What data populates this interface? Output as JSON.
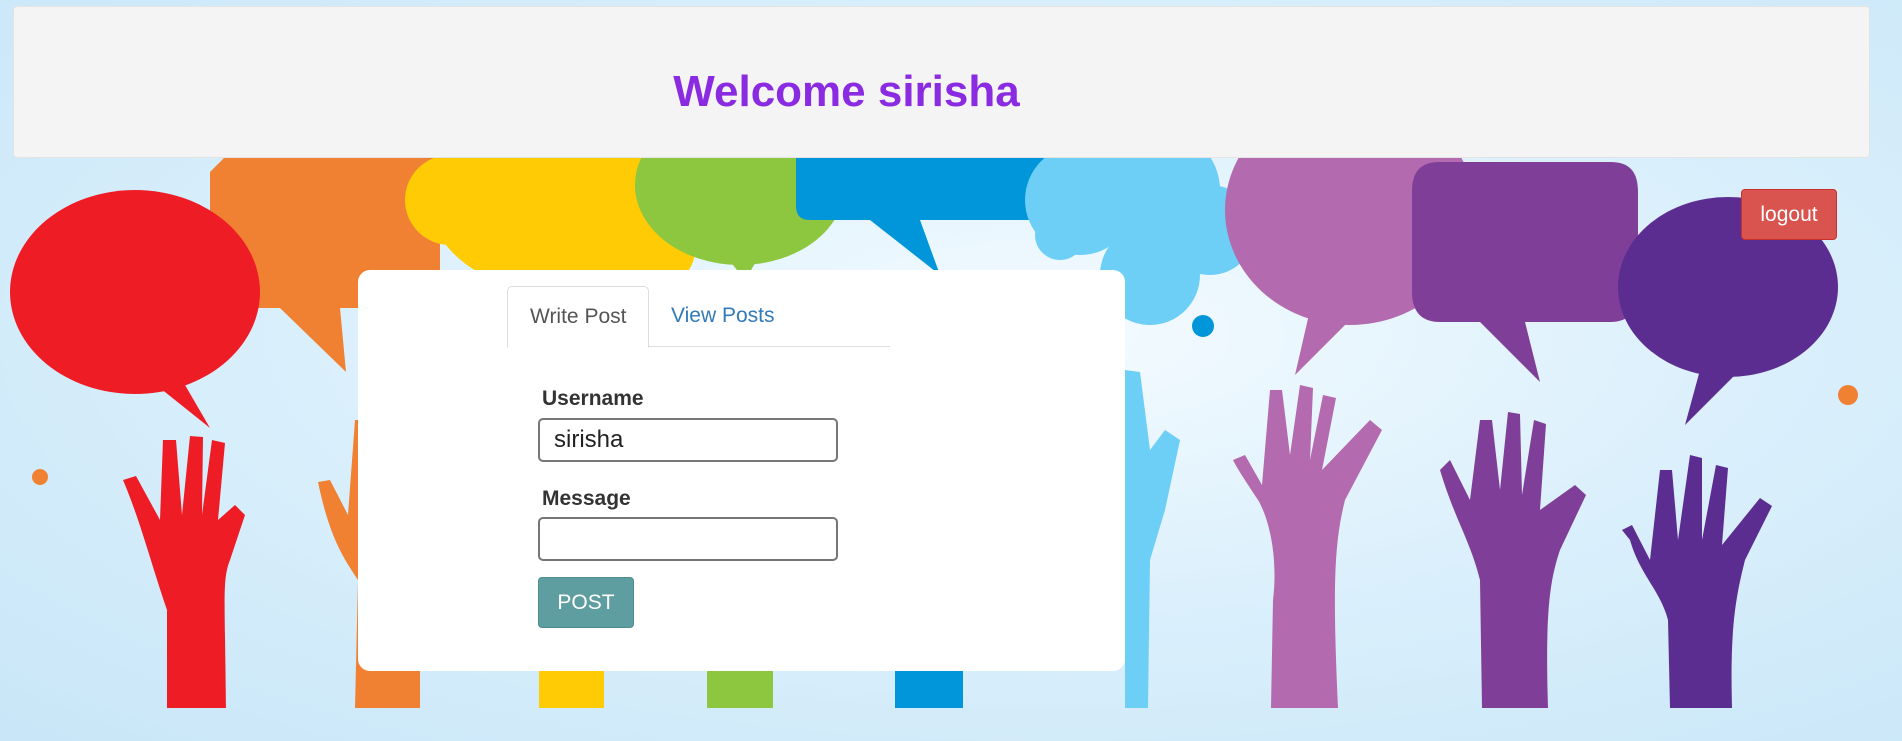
{
  "header": {
    "title": "Welcome sirisha"
  },
  "logout_label": "logout",
  "tabs": [
    {
      "label": "Write Post",
      "active": true
    },
    {
      "label": "View Posts",
      "active": false
    }
  ],
  "form": {
    "username_label": "Username",
    "username_value": "sirisha",
    "message_label": "Message",
    "message_value": "",
    "post_label": "POST"
  },
  "colors": {
    "title": "#8a2be2",
    "logout": "#d9534f",
    "post_button": "#5f9ea0",
    "link": "#337ab7"
  }
}
